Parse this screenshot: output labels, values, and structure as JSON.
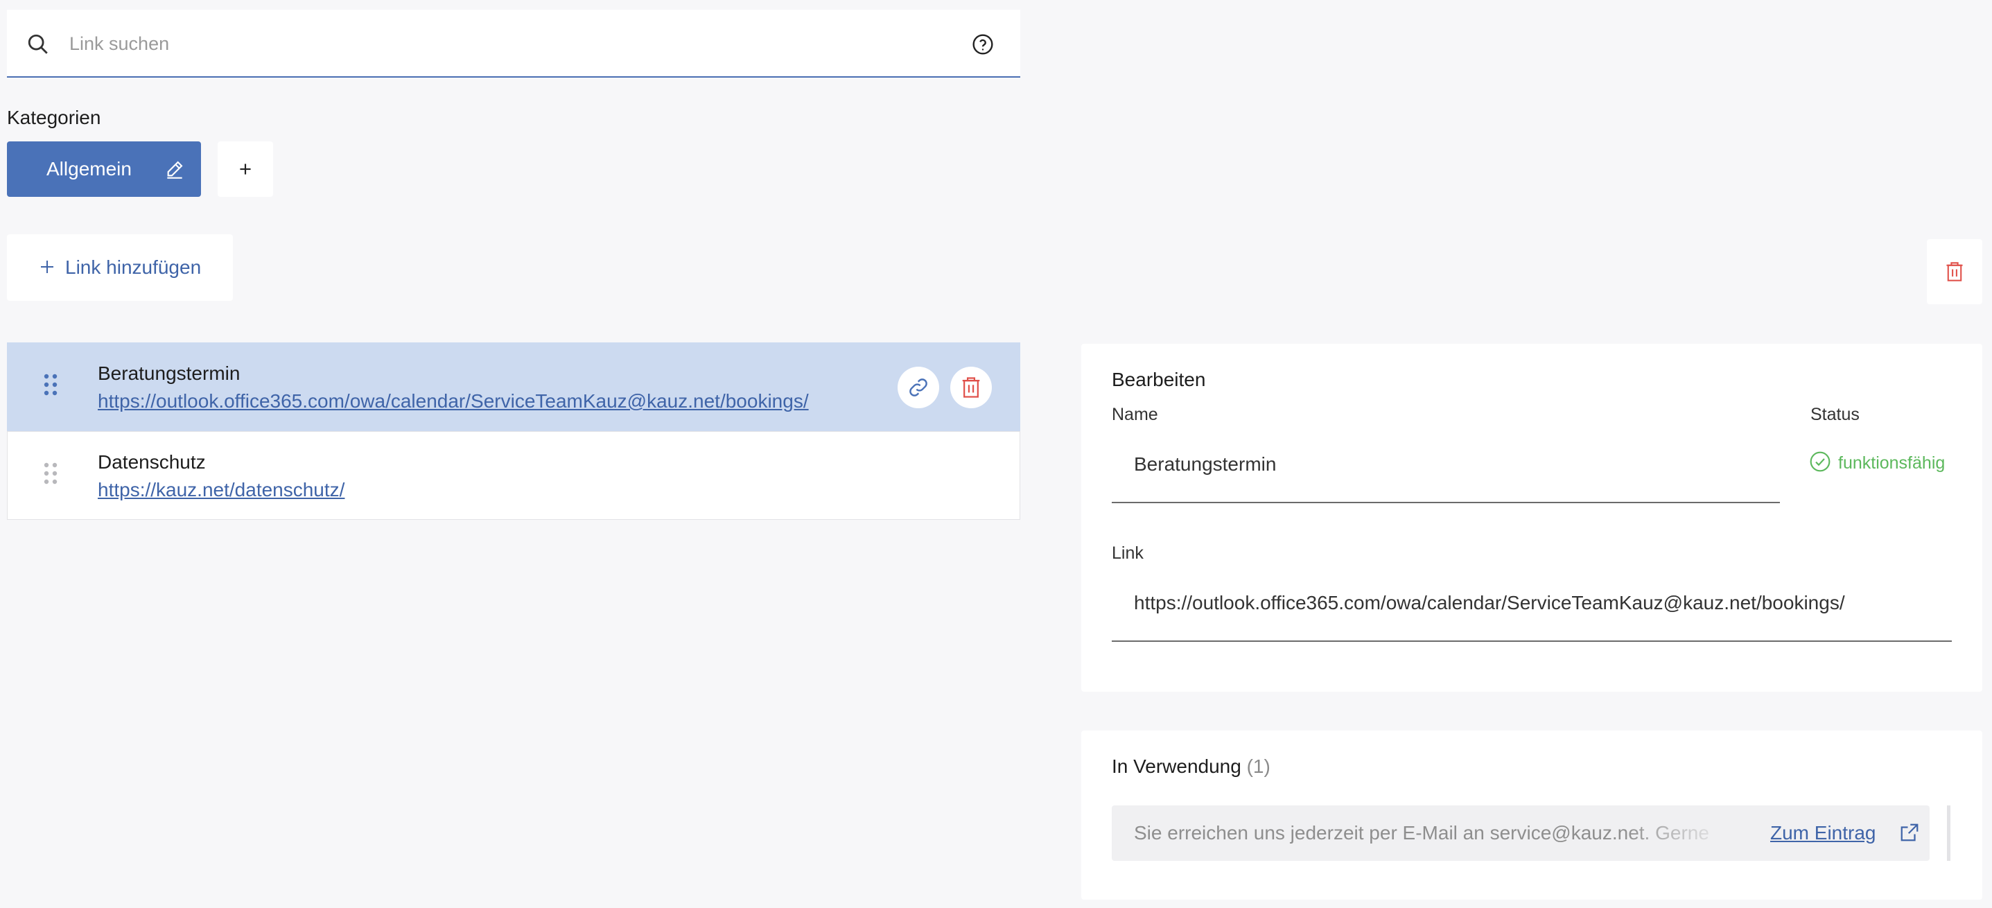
{
  "search": {
    "placeholder": "Link suchen"
  },
  "categories": {
    "label": "Kategorien",
    "items": [
      {
        "label": "Allgemein",
        "active": true
      }
    ]
  },
  "actions": {
    "add_link_label": "Link hinzufügen"
  },
  "links": [
    {
      "name": "Beratungstermin",
      "url": "https://outlook.office365.com/owa/calendar/ServiceTeamKauz@kauz.net/bookings/",
      "selected": true
    },
    {
      "name": "Datenschutz",
      "url": "https://kauz.net/datenschutz/",
      "selected": false
    }
  ],
  "edit": {
    "title": "Bearbeiten",
    "name_label": "Name",
    "name_value": "Beratungstermin",
    "status_label": "Status",
    "status_value": "funktionsfähig",
    "link_label": "Link",
    "link_value": "https://outlook.office365.com/owa/calendar/ServiceTeamKauz@kauz.net/bookings/"
  },
  "usage": {
    "title": "In Verwendung",
    "count": "(1)",
    "entries": [
      {
        "text": "Sie erreichen uns jederzeit per E-Mail an service@kauz.net. Gerne",
        "action": "Zum Eintrag"
      }
    ]
  },
  "colors": {
    "accent": "#4a72b8",
    "link": "#3f64a8",
    "selected_row": "#ccdaf0",
    "ok": "#5cb85c",
    "danger": "#e0504a"
  },
  "icons": [
    "search-icon",
    "help-icon",
    "pencil-icon",
    "plus-icon",
    "trash-icon",
    "drag-handle-icon",
    "link-icon",
    "check-circle-icon",
    "external-link-icon"
  ]
}
